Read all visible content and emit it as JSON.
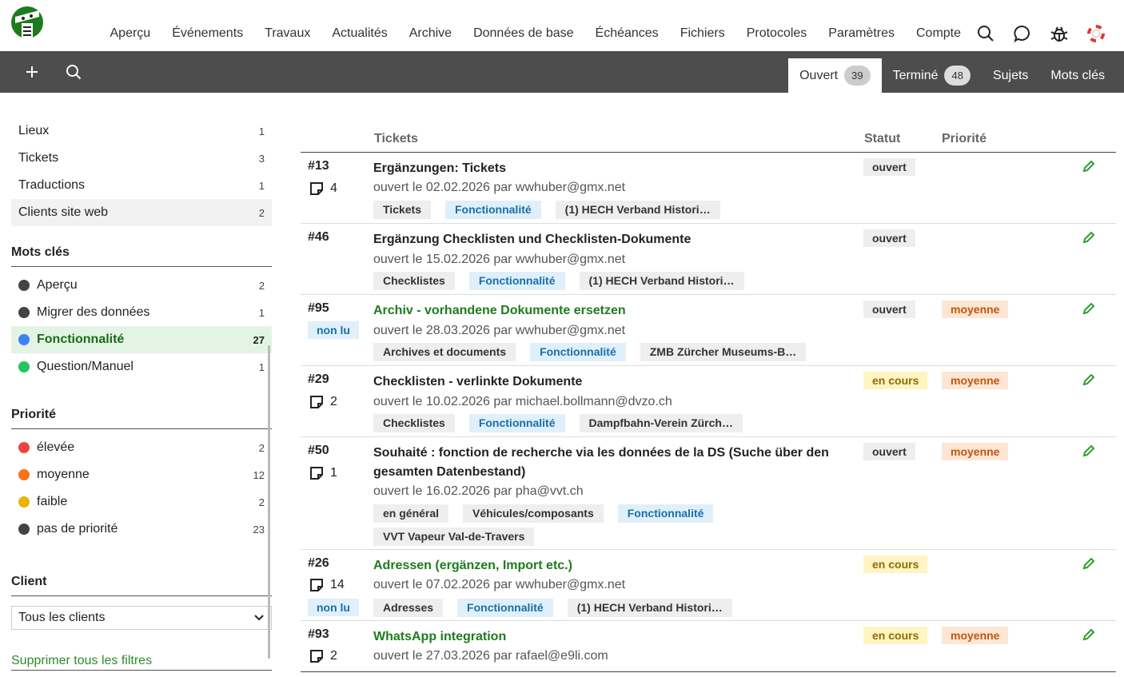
{
  "nav": {
    "links": [
      "Aperçu",
      "Événements",
      "Travaux",
      "Actualités",
      "Archive",
      "Données de base",
      "Échéances",
      "Fichiers",
      "Protocoles",
      "Paramètres",
      "Compte"
    ]
  },
  "tabs": [
    {
      "label": "Ouvert",
      "count": "39"
    },
    {
      "label": "Terminé",
      "count": "48"
    },
    {
      "label": "Sujets"
    },
    {
      "label": "Mots clés"
    }
  ],
  "sidebar": {
    "categories": [
      {
        "label": "Lieux",
        "count": "1"
      },
      {
        "label": "Tickets",
        "count": "3"
      },
      {
        "label": "Traductions",
        "count": "1"
      },
      {
        "label": "Clients site web",
        "count": "2"
      }
    ],
    "keywords_heading": "Mots clés",
    "keywords": [
      {
        "label": "Aperçu",
        "count": "2",
        "color": "#444444"
      },
      {
        "label": "Migrer des données",
        "count": "1",
        "color": "#444444"
      },
      {
        "label": "Fonctionnalité",
        "count": "27",
        "color": "#3b82f6"
      },
      {
        "label": "Question/Manuel",
        "count": "1",
        "color": "#22c55e"
      }
    ],
    "priority_heading": "Priorité",
    "priorities": [
      {
        "label": "élevée",
        "count": "2",
        "color": "#ef4444"
      },
      {
        "label": "moyenne",
        "count": "12",
        "color": "#f97316"
      },
      {
        "label": "faible",
        "count": "2",
        "color": "#eab308"
      },
      {
        "label": "pas de priorité",
        "count": "23",
        "color": "#444444"
      }
    ],
    "client_heading": "Client",
    "client_select": "Tous les clients",
    "clear_filters": "Supprimer tous les filtres"
  },
  "table": {
    "headers": {
      "tickets": "Tickets",
      "status": "Statut",
      "priority": "Priorité"
    },
    "rows": [
      {
        "id": "#13",
        "comments": "4",
        "unread": "",
        "title": "Ergänzungen: Tickets",
        "meta": "ouvert le 02.02.2026 par wwhuber@gmx.net",
        "tags": [
          "Tickets",
          "Fonctionnalité",
          "(1) HECH Verband Histori…"
        ],
        "status": "ouvert",
        "priority": ""
      },
      {
        "id": "#46",
        "comments": "",
        "unread": "",
        "title": "Ergänzung Checklisten und Checklisten-Dokumente",
        "meta": "ouvert le 15.02.2026 par wwhuber@gmx.net",
        "tags": [
          "Checklistes",
          "Fonctionnalité",
          "(1) HECH Verband Histori…"
        ],
        "status": "ouvert",
        "priority": ""
      },
      {
        "id": "#95",
        "comments": "",
        "unread": "non lu",
        "title": "Archiv - vorhandene Dokumente ersetzen",
        "meta": "ouvert le 28.03.2026 par wwhuber@gmx.net",
        "tags": [
          "Archives et documents",
          "Fonctionnalité",
          "ZMB Zürcher Museums-B…"
        ],
        "status": "ouvert",
        "priority": "moyenne"
      },
      {
        "id": "#29",
        "comments": "2",
        "unread": "",
        "title": "Checklisten - verlinkte Dokumente",
        "meta": "ouvert le 10.02.2026 par michael.bollmann@dvzo.ch",
        "tags": [
          "Checklistes",
          "Fonctionnalité",
          "Dampfbahn-Verein Zürch…"
        ],
        "status": "en cours",
        "priority": "moyenne"
      },
      {
        "id": "#50",
        "comments": "1",
        "unread": "",
        "title": "Souhaité : fonction de recherche via les données de la DS (Suche über den gesamten Datenbestand)",
        "meta": "ouvert le 16.02.2026 par pha@vvt.ch",
        "tags": [
          "en général",
          "Véhicules/composants",
          "Fonctionnalité",
          "VVT Vapeur Val-de-Travers"
        ],
        "status": "ouvert",
        "priority": "moyenne"
      },
      {
        "id": "#26",
        "comments": "14",
        "unread": "non lu",
        "title": "Adressen (ergänzen, Import etc.)",
        "meta": "ouvert le 07.02.2026 par wwhuber@gmx.net",
        "tags": [
          "Adresses",
          "Fonctionnalité",
          "(1) HECH Verband Histori…"
        ],
        "status": "en cours",
        "priority": ""
      },
      {
        "id": "#93",
        "comments": "2",
        "unread": "",
        "title": "WhatsApp integration",
        "meta": "ouvert le 27.03.2026 par rafael@e9li.com",
        "tags": [],
        "status": "en cours",
        "priority": "moyenne"
      }
    ]
  }
}
